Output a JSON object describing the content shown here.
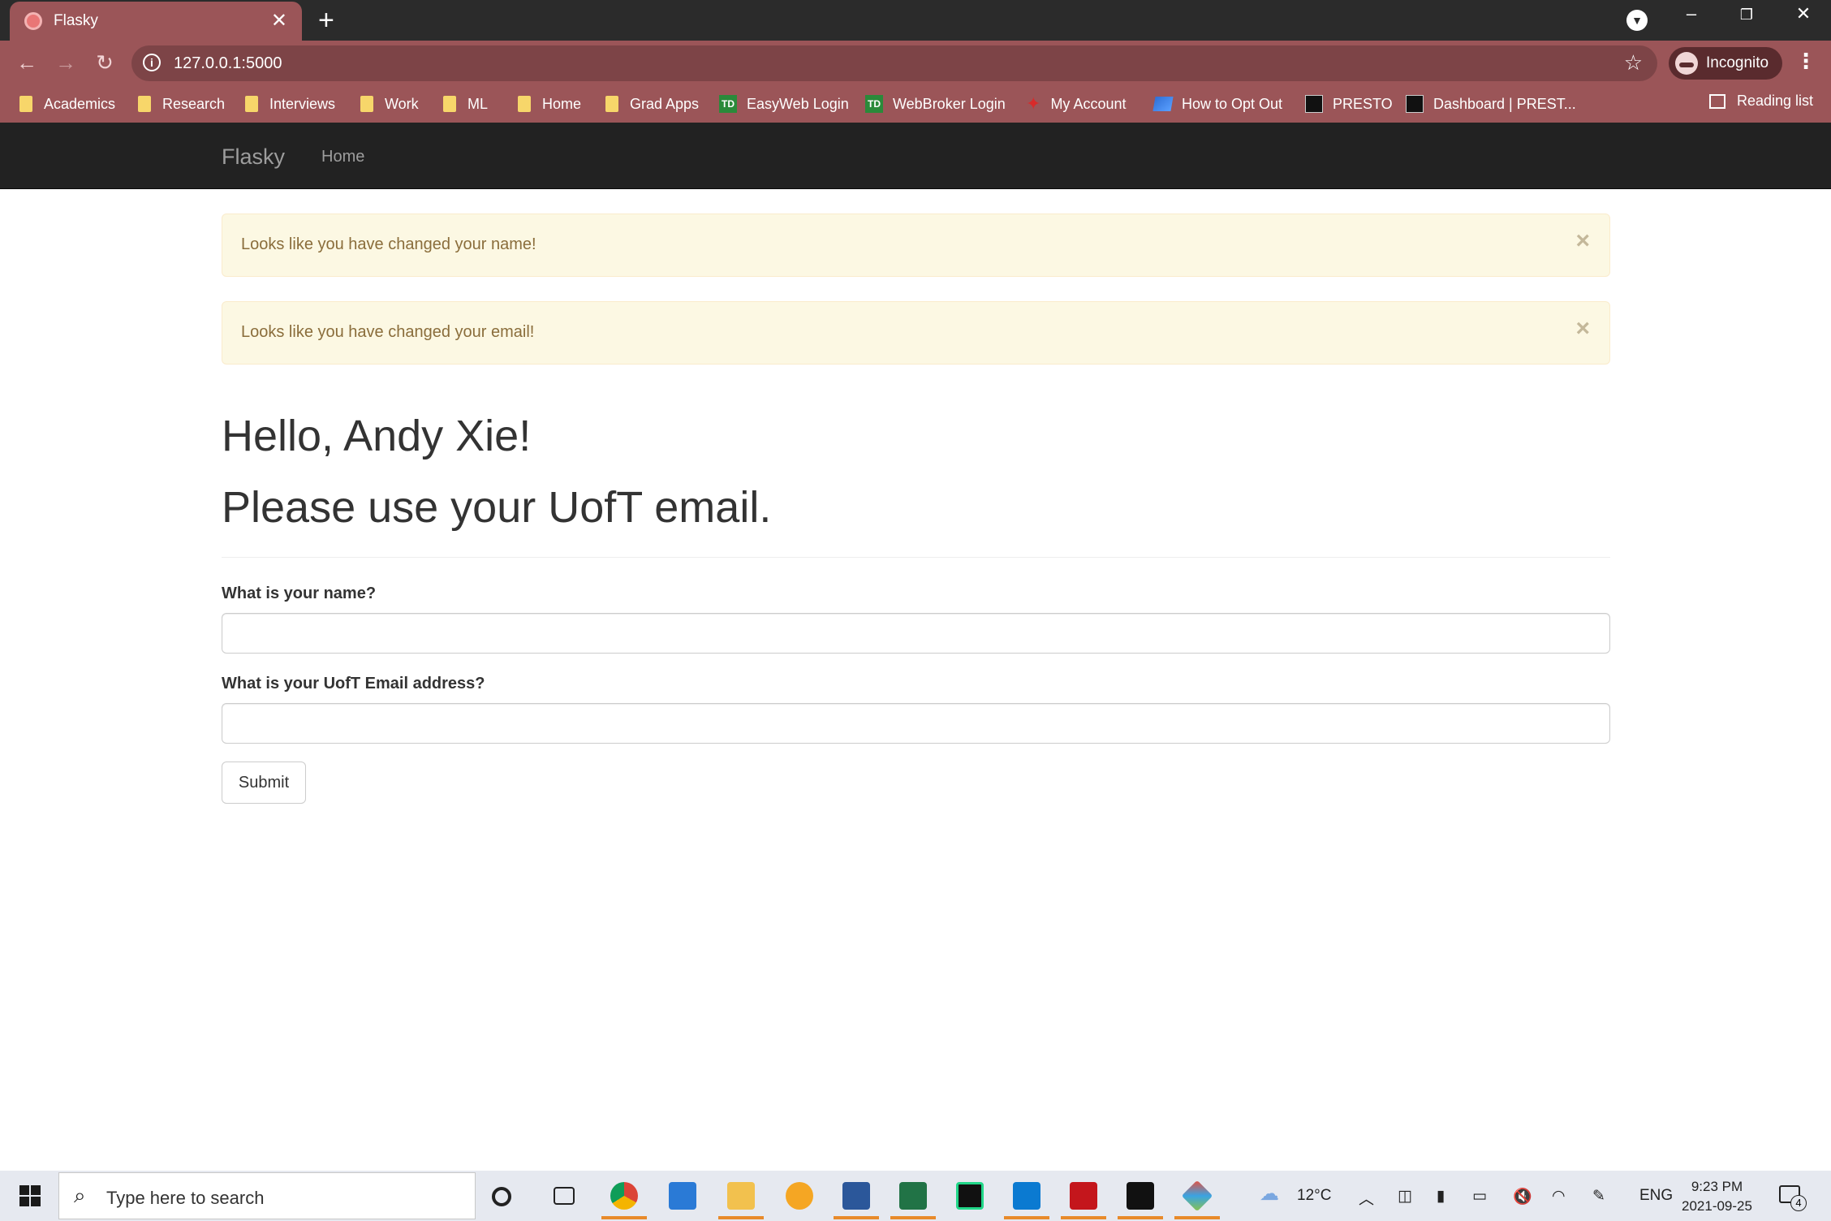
{
  "browser": {
    "tab_title": "Flasky",
    "url": "127.0.0.1:5000",
    "profile_label": "Incognito",
    "bookmarks": [
      {
        "label": "Academics",
        "icon": "folder-icon"
      },
      {
        "label": "Research",
        "icon": "folder-icon"
      },
      {
        "label": "Interviews",
        "icon": "folder-icon"
      },
      {
        "label": "Work",
        "icon": "folder-icon"
      },
      {
        "label": "ML",
        "icon": "folder-icon"
      },
      {
        "label": "Home",
        "icon": "folder-icon"
      },
      {
        "label": "Grad Apps",
        "icon": "folder-icon"
      },
      {
        "label": "EasyWeb Login",
        "icon": "td-bank-icon"
      },
      {
        "label": "WebBroker Login",
        "icon": "td-bank-icon"
      },
      {
        "label": "My Account",
        "icon": "maple-leaf-icon"
      },
      {
        "label": "How to Opt Out",
        "icon": "blue-logo-icon"
      },
      {
        "label": "PRESTO",
        "icon": "presto-icon"
      },
      {
        "label": "Dashboard | PREST...",
        "icon": "presto-icon"
      }
    ],
    "reading_list": "Reading list",
    "td_badge": "TD"
  },
  "navbar": {
    "brand": "Flasky",
    "home": "Home"
  },
  "alerts": [
    {
      "message": "Looks like you have changed your name!",
      "close": "×"
    },
    {
      "message": "Looks like you have changed your email!",
      "close": "×"
    }
  ],
  "header": {
    "greeting": "Hello, Andy Xie!",
    "subtitle": "Please use your UofT email."
  },
  "form": {
    "name_label": "What is your name?",
    "name_value": "",
    "email_label": "What is your UofT Email address?",
    "email_value": "",
    "submit_label": "Submit"
  },
  "taskbar": {
    "search_placeholder": "Type here to search",
    "weather": "12°C",
    "language": "ENG",
    "time": "9:23 PM",
    "date": "2021-09-25",
    "notification_count": "4"
  },
  "colors": {
    "chrome_accent": "#9b5558",
    "navbar_bg": "#222222",
    "alert_bg": "#fcf8e3",
    "alert_text": "#8a6d3b"
  }
}
